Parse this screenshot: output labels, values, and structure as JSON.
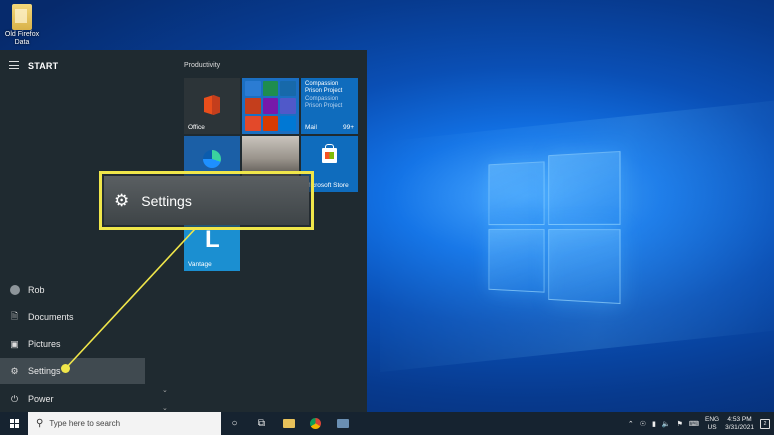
{
  "desktop": {
    "icon_label": "Old Firefox Data"
  },
  "start_menu": {
    "title": "START",
    "rail": [
      {
        "label": "Rob",
        "icon": "avatar"
      },
      {
        "label": "Documents",
        "icon": "document-icon"
      },
      {
        "label": "Pictures",
        "icon": "picture-icon"
      },
      {
        "label": "Settings",
        "icon": "gear-icon"
      },
      {
        "label": "Power",
        "icon": "power-icon"
      }
    ],
    "group": "Productivity",
    "tiles": {
      "office": "Office",
      "mail_title": "Compassion Prison Project",
      "mail_sub": "Compassion Prison Project",
      "mail_label": "Mail",
      "mail_count": "99+",
      "store": "Microsoft Store",
      "vantage": "Vantage"
    }
  },
  "callout": {
    "label": "Settings"
  },
  "taskbar": {
    "search_placeholder": "Type here to search",
    "lang_top": "ENG",
    "lang_bottom": "US",
    "time": "4:53 PM",
    "date": "3/31/2021",
    "notification_count": "2"
  },
  "colors": {
    "accent": "#f0e64a",
    "menu_bg": "#1f2a30",
    "tile_blue": "#0f6cbd"
  }
}
